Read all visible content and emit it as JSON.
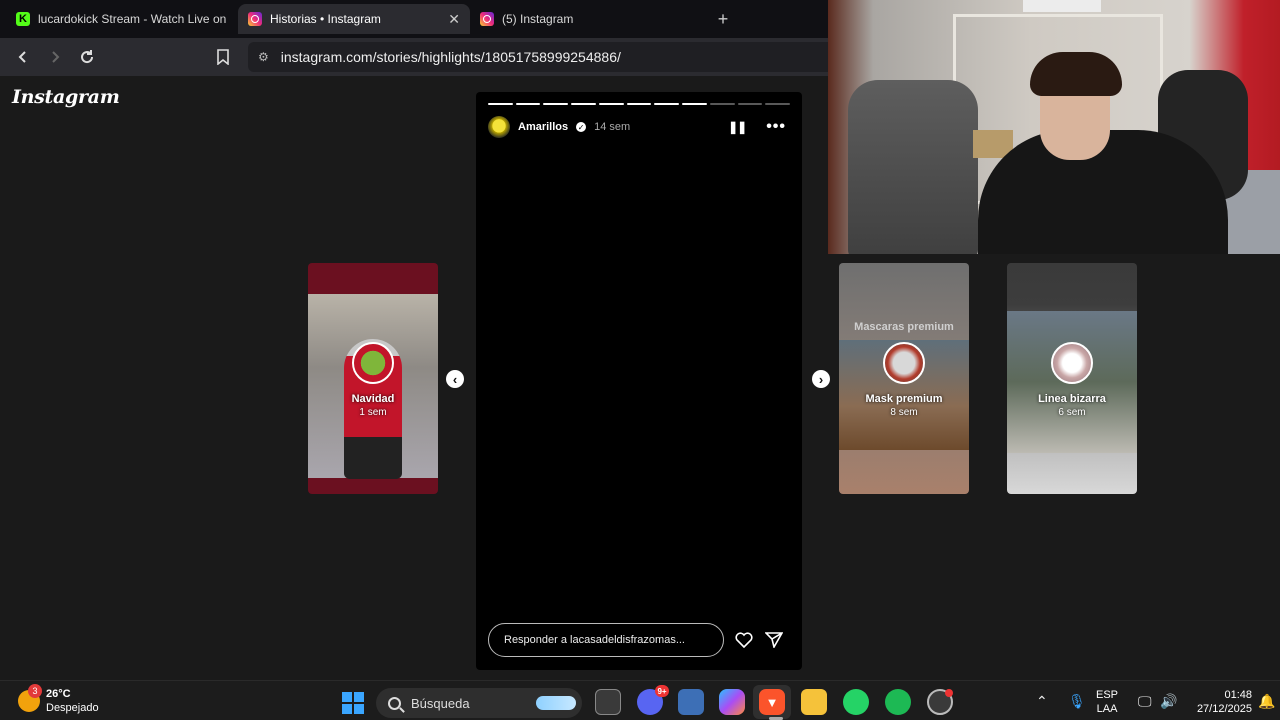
{
  "browser": {
    "tabs": [
      {
        "title": "lucardokick Stream - Watch Live on K",
        "icon": "kick-icon",
        "active": false
      },
      {
        "title": "Historias • Instagram",
        "icon": "instagram-icon",
        "active": true,
        "close": "✕"
      },
      {
        "title": "(5) Instagram",
        "icon": "instagram-icon",
        "active": false
      }
    ],
    "new_tab": "+",
    "url": "instagram.com/stories/highlights/18051758999254886/"
  },
  "instagram": {
    "logo": "Instagram",
    "story": {
      "username": "Amarillos",
      "time": "14 sem",
      "progress_total": 11,
      "progress_done": 8,
      "reply_placeholder": "Responder a lacasadeldisfrazomas..."
    },
    "highlights": [
      {
        "title": "Navidad",
        "time": "1 sem"
      },
      {
        "title": "Mask premium",
        "time": "8 sem",
        "overlay": "Mascaras premium"
      },
      {
        "title": "Linea bizarra",
        "time": "6 sem"
      }
    ]
  },
  "taskbar": {
    "weather": {
      "temp": "26°C",
      "desc": "Despejado",
      "badge": "3"
    },
    "search_placeholder": "Búsqueda",
    "discord_badge": "9+",
    "lang": {
      "line1": "ESP",
      "line2": "LAA"
    },
    "clock": {
      "time": "01:48",
      "date": "27/12/2025"
    }
  },
  "colors": {
    "brave": "#fb542b",
    "kick": "#53fc18",
    "spotify": "#1db954",
    "whatsapp": "#25d366",
    "discord": "#5865f2"
  }
}
